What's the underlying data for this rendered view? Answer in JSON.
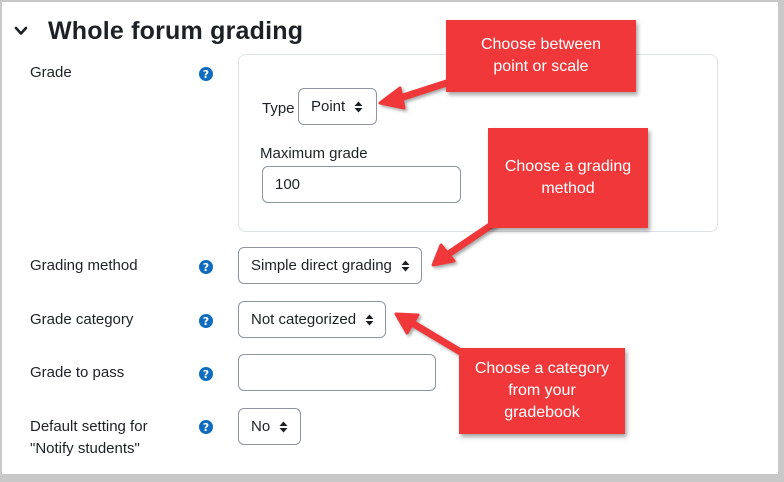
{
  "section": {
    "title": "Whole forum grading",
    "expanded": true
  },
  "icons": {
    "chevron": "chevron-down-icon",
    "help": "question-circle-icon"
  },
  "colors": {
    "help": "#0f6cbf",
    "callout": "#f0383b",
    "border": "#8f959e"
  },
  "grade": {
    "label": "Grade",
    "type_label": "Type",
    "type_value": "Point",
    "max_label": "Maximum grade",
    "max_value": "100"
  },
  "grading_method": {
    "label": "Grading method",
    "value": "Simple direct grading"
  },
  "grade_category": {
    "label": "Grade category",
    "value": "Not categorized"
  },
  "grade_to_pass": {
    "label": "Grade to pass",
    "value": ""
  },
  "notify": {
    "label_line1": "Default setting for",
    "label_line2": "\"Notify students\"",
    "value": "No"
  },
  "callouts": [
    {
      "line1": "Choose between",
      "line2": "point or scale"
    },
    {
      "line1": "Choose a grading",
      "line2": "method"
    },
    {
      "line1": "Choose a category",
      "line2": "from your",
      "line3": "gradebook"
    }
  ]
}
